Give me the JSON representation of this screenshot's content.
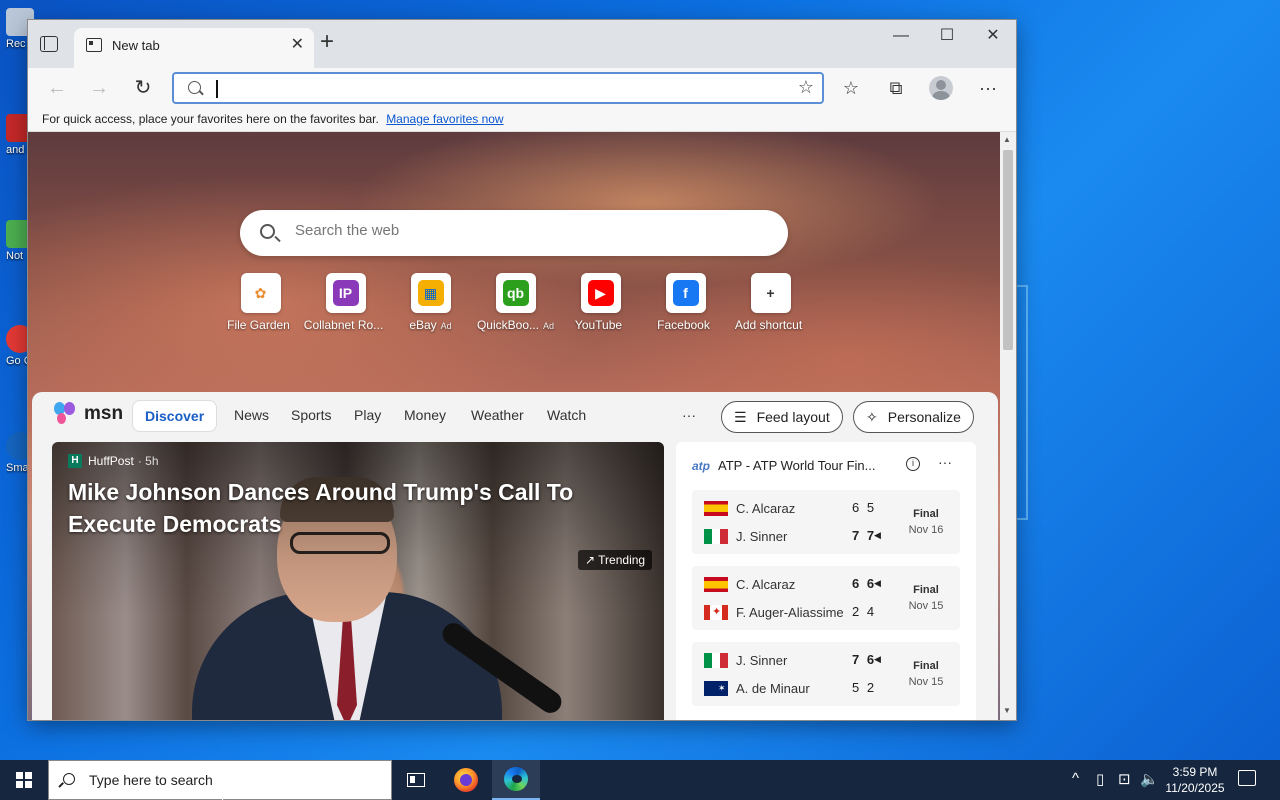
{
  "desktop": {
    "icons": [
      {
        "label": "Rec",
        "color": "#b9c7d8"
      },
      {
        "label": "and edit",
        "color": "#c62828"
      },
      {
        "label": "Not",
        "color": "#4caf50"
      },
      {
        "label": "Go Ch",
        "color": "#e53935"
      },
      {
        "label": "Sma",
        "color": "#1565c0"
      }
    ]
  },
  "browser": {
    "tab_title": "New tab",
    "address_value": "",
    "favorites_bar": {
      "text": "For quick access, place your favorites here on the favorites bar.",
      "link": "Manage favorites now"
    },
    "icons": {
      "back": "←",
      "forward": "→",
      "refresh": "↻",
      "add_favorite": "☆",
      "favorites": "☆",
      "collections": "⧉",
      "menu": "···",
      "minimize": "—",
      "maximize": "☐",
      "close": "✕",
      "new_tab": "+",
      "tab_close": "✕"
    }
  },
  "newtab": {
    "search_placeholder": "Search the web",
    "shortcuts": [
      {
        "label": "File Garden",
        "ad": "",
        "icon": "file-garden-icon",
        "bg": "#ffffff",
        "fg": "#e88c2d",
        "glyph": "✿"
      },
      {
        "label": "Collabnet Ro...",
        "ad": "",
        "icon": "collabnet-icon",
        "bg": "#8a3ab9",
        "fg": "#ffffff",
        "glyph": "IP"
      },
      {
        "label": "eBay",
        "ad": "Ad",
        "icon": "ebay-icon",
        "bg": "#f5af02",
        "fg": "#0064d2",
        "glyph": "▦"
      },
      {
        "label": "QuickBoo...",
        "ad": "Ad",
        "icon": "quickbooks-icon",
        "bg": "#2ca01c",
        "fg": "#ffffff",
        "glyph": "qb"
      },
      {
        "label": "YouTube",
        "ad": "",
        "icon": "youtube-icon",
        "bg": "#ff0000",
        "fg": "#ffffff",
        "glyph": "▶"
      },
      {
        "label": "Facebook",
        "ad": "",
        "icon": "facebook-icon",
        "bg": "#1877f2",
        "fg": "#ffffff",
        "glyph": "f"
      },
      {
        "label": "Add shortcut",
        "ad": "",
        "icon": "plus-icon",
        "bg": "#ffffff",
        "fg": "#333333",
        "glyph": "+"
      }
    ]
  },
  "msn": {
    "logo": "msn",
    "nav": [
      "Discover",
      "News",
      "Sports",
      "Play",
      "Money",
      "Weather",
      "Watch"
    ],
    "more": "···",
    "feed_layout": "Feed layout",
    "personalize": "Personalize",
    "hero": {
      "source": "HuffPost",
      "source_logo": "H",
      "age": "· 5h",
      "headline": "Mike Johnson Dances Around Trump's Call To Execute Democrats",
      "badge": "↗ Trending"
    },
    "sports": {
      "title": "ATP - ATP World Tour Fin...",
      "matches": [
        {
          "p1": "C. Alcaraz",
          "f1": "es",
          "s1": "6 5",
          "w1": false,
          "p2": "J. Sinner",
          "f2": "it",
          "s2": "7 7",
          "w2": true,
          "status": "Final",
          "date": "Nov 16"
        },
        {
          "p1": "C. Alcaraz",
          "f1": "es",
          "s1": "6 6",
          "w1": true,
          "p2": "F. Auger-Aliassime",
          "f2": "ca",
          "s2": "2 4",
          "w2": false,
          "status": "Final",
          "date": "Nov 15"
        },
        {
          "p1": "J. Sinner",
          "f1": "it",
          "s1": "7 6",
          "w1": true,
          "p2": "A. de Minaur",
          "f2": "au",
          "s2": "5 2",
          "w2": false,
          "status": "Final",
          "date": "Nov 15"
        }
      ]
    }
  },
  "taskbar": {
    "search_placeholder": "Type here to search",
    "time": "3:59 PM",
    "date": "11/20/2025",
    "tray": {
      "chevron": "^",
      "battery": "▯",
      "network": "⊡",
      "volume": "🔈"
    }
  }
}
